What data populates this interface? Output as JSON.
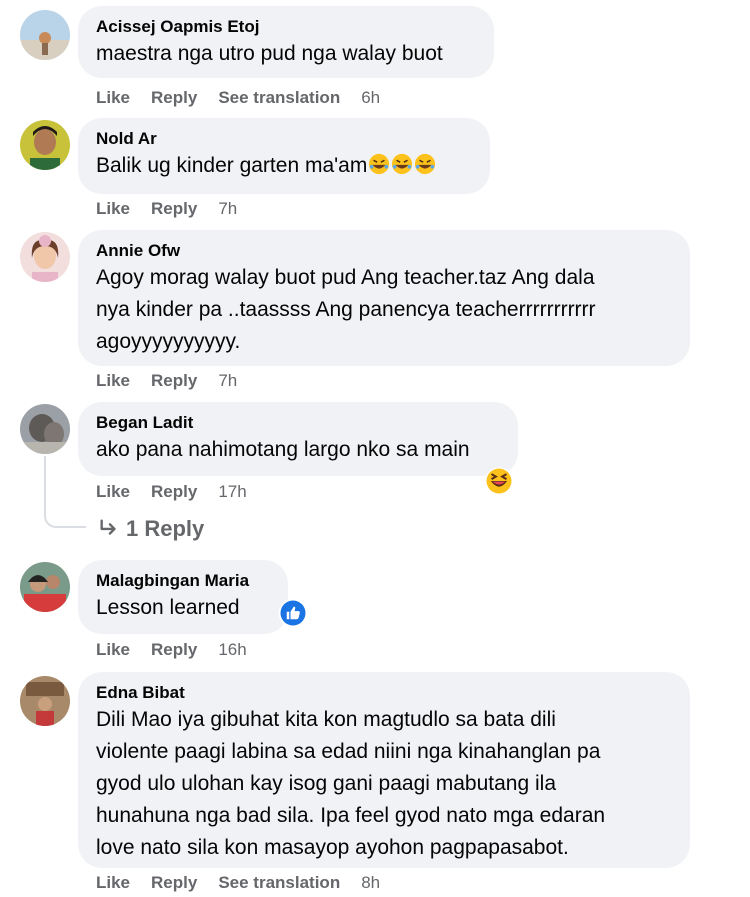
{
  "comments": [
    {
      "author": "Acissej Oapmis Etoj",
      "text": "maestra nga utro pud nga walay buot",
      "actions": [
        "Like",
        "Reply",
        "See translation"
      ],
      "time": "6h",
      "avatar_icon": "profile-photo"
    },
    {
      "author": "Nold Ar",
      "text": "Balik ug kinder garten ma'am",
      "emoji": [
        "rolling-on-floor-laughing-emoji",
        "rolling-on-floor-laughing-emoji",
        "rolling-on-floor-laughing-emoji"
      ],
      "actions": [
        "Like",
        "Reply"
      ],
      "time": "7h",
      "avatar_icon": "profile-photo"
    },
    {
      "author": "Annie Ofw",
      "text_lines": [
        "Agoy morag walay buot pud Ang teacher.taz Ang dala",
        "nya kinder pa ..taassss Ang panencya teacherrrrrrrrrrr",
        "agoyyyyyyyyyy."
      ],
      "actions": [
        "Like",
        "Reply"
      ],
      "time": "7h",
      "avatar_icon": "profile-photo"
    },
    {
      "author": "Began Ladit",
      "text": "ako pana nahimotang largo nko sa main",
      "reaction": "haha-reaction-icon",
      "actions": [
        "Like",
        "Reply"
      ],
      "time": "17h",
      "replies_label": "1 Reply",
      "avatar_icon": "profile-photo"
    },
    {
      "author": "Malagbingan Maria",
      "text": "Lesson learned",
      "reaction": "like-reaction-icon",
      "actions": [
        "Like",
        "Reply"
      ],
      "time": "16h",
      "avatar_icon": "profile-photo"
    },
    {
      "author": "Edna Bibat",
      "text_lines": [
        "Dili Mao iya gibuhat kita kon magtudlo sa bata dili",
        "violente paagi labina sa edad niini nga kinahanglan pa",
        "gyod ulo ulohan kay isog gani paagi mabutang ila",
        "hunahuna nga bad sila. Ipa feel gyod nato mga edaran",
        "love nato sila kon masayop ayohon pagpapasabot."
      ],
      "actions": [
        "Like",
        "Reply",
        "See translation"
      ],
      "time": "8h",
      "avatar_icon": "profile-photo"
    }
  ],
  "colors": {
    "bubble": "#f0f2f5",
    "muted": "#65676b",
    "text": "#050505",
    "like_blue": "#1b74e4",
    "emoji_yellow": "#fcc21b"
  }
}
